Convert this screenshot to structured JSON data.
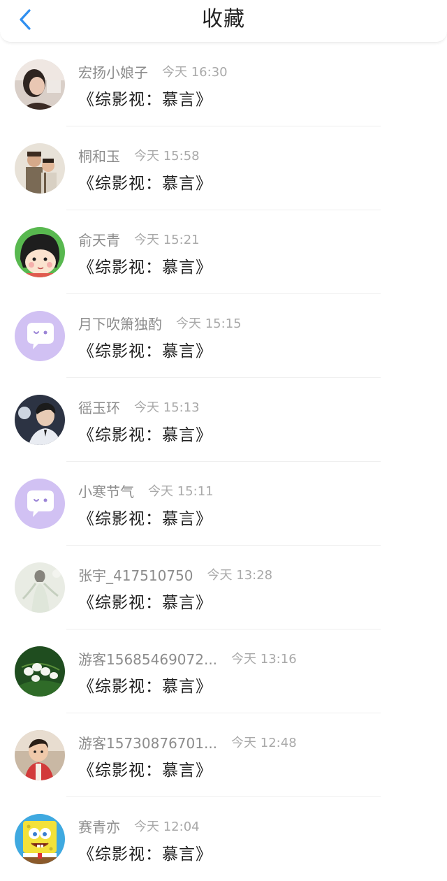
{
  "header": {
    "title": "收藏",
    "back_icon": "chevron-left-icon",
    "accent": "#2f8ff0"
  },
  "items": [
    {
      "name": "宏扬小娘子",
      "time": "今天 16:30",
      "book": "《综影视：慕言》",
      "avatar": "avatar-photo-girl"
    },
    {
      "name": "桐和玉",
      "time": "今天 15:58",
      "book": "《综影视：慕言》",
      "avatar": "avatar-photo-two-people"
    },
    {
      "name": "俞天青",
      "time": "今天 15:21",
      "book": "《综影视：慕言》",
      "avatar": "avatar-cartoon-girl"
    },
    {
      "name": "月下吹箫独酌",
      "time": "今天 15:15",
      "book": "《综影视：慕言》",
      "avatar": "avatar-default-chat-bubble"
    },
    {
      "name": "徭玉环",
      "time": "今天 15:13",
      "book": "《综影视：慕言》",
      "avatar": "avatar-photo-boy"
    },
    {
      "name": "小寒节气",
      "time": "今天 15:11",
      "book": "《综影视：慕言》",
      "avatar": "avatar-default-chat-bubble"
    },
    {
      "name": "张宇_417510750",
      "time": "今天 13:28",
      "book": "《综影视：慕言》",
      "avatar": "avatar-illustration-figure"
    },
    {
      "name": "游客15685469072...",
      "time": "今天 13:16",
      "book": "《综影视：慕言》",
      "avatar": "avatar-lily-of-the-valley"
    },
    {
      "name": "游客15730876701...",
      "time": "今天 12:48",
      "book": "《综影视：慕言》",
      "avatar": "avatar-photo-child"
    },
    {
      "name": "赛青亦",
      "time": "今天 12:04",
      "book": "《综影视：慕言》",
      "avatar": "avatar-cartoon-sponge"
    }
  ]
}
